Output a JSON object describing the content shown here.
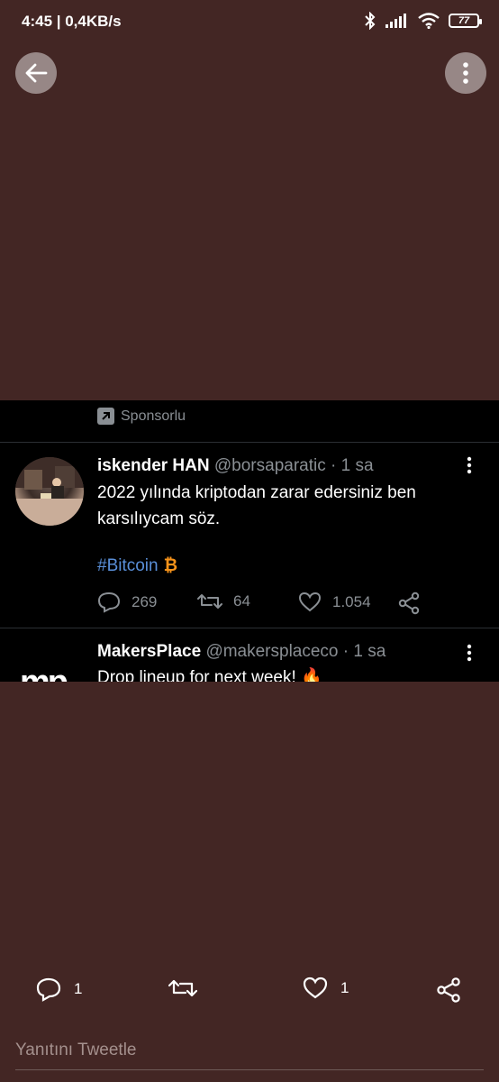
{
  "status_bar": {
    "time": "4:45 | 0,4KB/s",
    "battery": "77",
    "icons": [
      "bluetooth-icon",
      "signal-icon",
      "wifi-icon",
      "battery-icon"
    ]
  },
  "nav": {
    "back_icon": "arrow-left-icon",
    "more_icon": "more-vertical-icon"
  },
  "promoted": {
    "label": "Sponsorlu",
    "icon": "promoted-arrow-icon"
  },
  "tweet1": {
    "author": "iskender HAN",
    "meta": "@borsaparatic · 1 sa",
    "text": "2022 yılında kriptodan zarar edersiniz ben karsılıycam söz.",
    "hashtag": "#Bitcoin",
    "hashtag_emoji": "₿",
    "replies": "269",
    "retweets": "64",
    "likes": "1.054"
  },
  "tweet2": {
    "author": "MakersPlace",
    "meta": "@makersplaceco · 1 sa",
    "text": "Drop lineup for next week! 🔥",
    "avatar_text": "mp"
  },
  "bottom_bar": {
    "replies": "1",
    "likes": "1"
  },
  "reply_input": {
    "placeholder": "Yanıtını Tweetle"
  },
  "colors": {
    "background": "#432624",
    "card": "#000000",
    "hashtag": "#5a8fd8",
    "muted": "#8a8f94"
  }
}
